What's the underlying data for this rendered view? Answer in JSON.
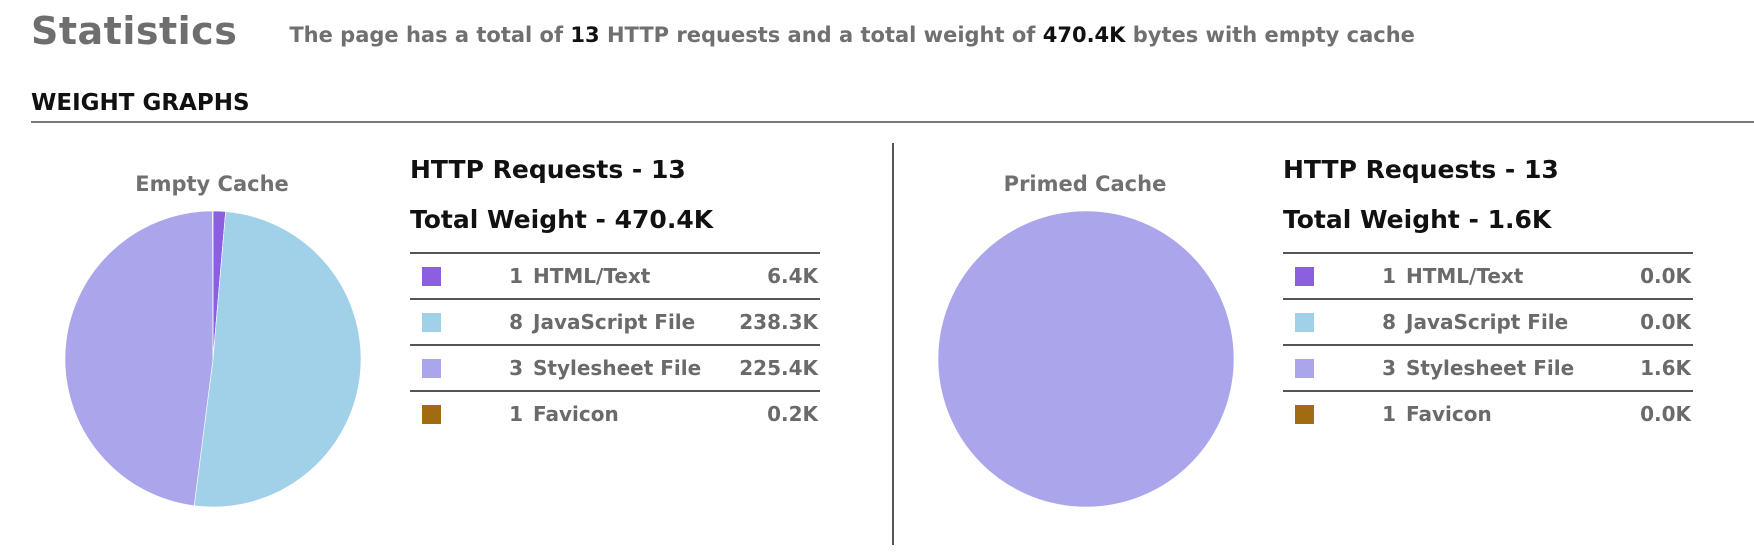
{
  "header": {
    "title": "Statistics",
    "summary_pre": "The page has a total of ",
    "summary_requests": "13",
    "summary_mid": " HTTP requests and a total weight of ",
    "summary_weight": "470.4K",
    "summary_post": " bytes with empty cache"
  },
  "section": {
    "title": "WEIGHT GRAPHS"
  },
  "colors": {
    "html": "#8b5fe0",
    "javascript": "#a1d1e8",
    "stylesheet": "#aba6ec",
    "favicon": "#a16c11"
  },
  "chart_data": [
    {
      "type": "pie",
      "title": "Empty Cache",
      "requests_label": "HTTP Requests - 13",
      "weight_label": "Total Weight - 470.4K",
      "slices": [
        {
          "count": "1",
          "label": "HTML/Text",
          "value_label": "6.4K",
          "value": 6.4,
          "color": "#8b5fe0"
        },
        {
          "count": "8",
          "label": "JavaScript File",
          "value_label": "238.3K",
          "value": 238.3,
          "color": "#a1d1e8"
        },
        {
          "count": "3",
          "label": "Stylesheet File",
          "value_label": "225.4K",
          "value": 225.4,
          "color": "#aba6ec"
        },
        {
          "count": "1",
          "label": "Favicon",
          "value_label": "0.2K",
          "value": 0.2,
          "color": "#a16c11"
        }
      ]
    },
    {
      "type": "pie",
      "title": "Primed Cache",
      "requests_label": "HTTP Requests - 13",
      "weight_label": "Total Weight - 1.6K",
      "slices": [
        {
          "count": "1",
          "label": "HTML/Text",
          "value_label": "0.0K",
          "value": 0.0,
          "color": "#8b5fe0"
        },
        {
          "count": "8",
          "label": "JavaScript File",
          "value_label": "0.0K",
          "value": 0.0,
          "color": "#a1d1e8"
        },
        {
          "count": "3",
          "label": "Stylesheet File",
          "value_label": "1.6K",
          "value": 1.6,
          "color": "#aba6ec"
        },
        {
          "count": "1",
          "label": "Favicon",
          "value_label": "0.0K",
          "value": 0.0,
          "color": "#a16c11"
        }
      ]
    }
  ]
}
